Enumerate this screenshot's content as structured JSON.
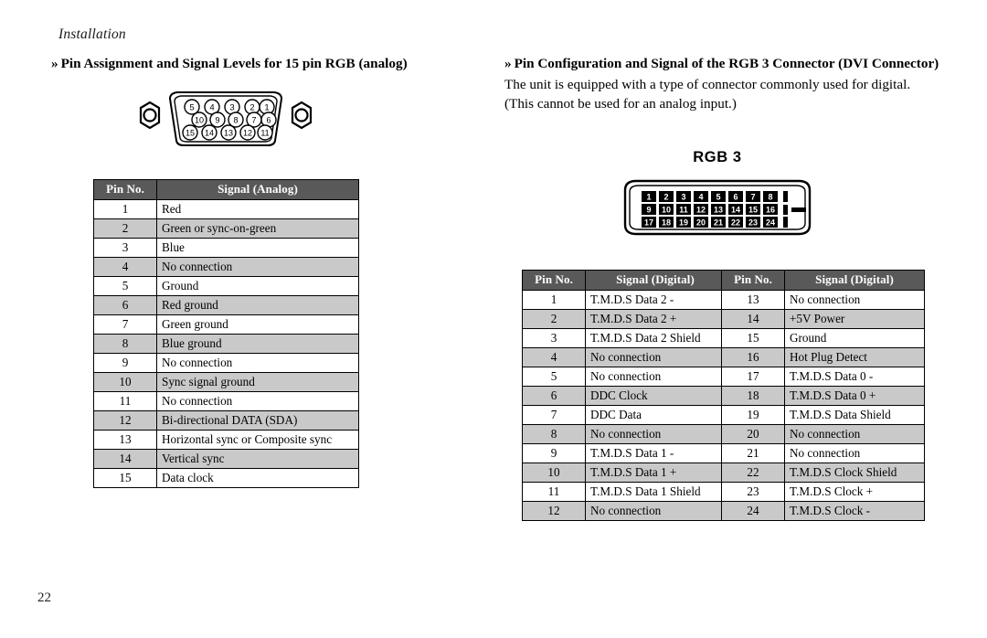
{
  "page": {
    "running_head": "Installation",
    "page_number": "22"
  },
  "left_column": {
    "heading_marker": "»",
    "heading": "Pin Assignment and Signal Levels for 15 pin RGB (analog)",
    "connector_diagram": {
      "name": "vga-d-sub-15-connector",
      "rows": [
        [
          "5",
          "4",
          "3",
          "2",
          "1"
        ],
        [
          "10",
          "9",
          "8",
          "7",
          "6"
        ],
        [
          "15",
          "14",
          "13",
          "12",
          "11"
        ]
      ]
    },
    "table": {
      "headers": [
        "Pin No.",
        "Signal (Analog)"
      ],
      "rows": [
        [
          "1",
          "Red"
        ],
        [
          "2",
          "Green or sync-on-green"
        ],
        [
          "3",
          "Blue"
        ],
        [
          "4",
          "No connection"
        ],
        [
          "5",
          "Ground"
        ],
        [
          "6",
          "Red ground"
        ],
        [
          "7",
          "Green ground"
        ],
        [
          "8",
          "Blue ground"
        ],
        [
          "9",
          "No connection"
        ],
        [
          "10",
          "Sync signal ground"
        ],
        [
          "11",
          "No connection"
        ],
        [
          "12",
          "Bi-directional DATA (SDA)"
        ],
        [
          "13",
          "Horizontal sync or Composite sync"
        ],
        [
          "14",
          "Vertical sync"
        ],
        [
          "15",
          "Data clock"
        ]
      ]
    }
  },
  "right_column": {
    "heading_marker": "»",
    "heading": "Pin Configuration and Signal of the RGB 3 Connector (DVI Connector)",
    "body": "The unit is equipped with a type of connector commonly used for digital. (This cannot be used for an analog input.)",
    "connector_label": "RGB 3",
    "connector_diagram": {
      "name": "dvi-connector",
      "rows": [
        [
          "1",
          "2",
          "3",
          "4",
          "5",
          "6",
          "7",
          "8"
        ],
        [
          "9",
          "10",
          "11",
          "12",
          "13",
          "14",
          "15",
          "16"
        ],
        [
          "17",
          "18",
          "19",
          "20",
          "21",
          "22",
          "23",
          "24"
        ]
      ]
    },
    "table_left": {
      "headers": [
        "Pin No.",
        "Signal (Digital)"
      ],
      "rows": [
        [
          "1",
          "T.M.D.S Data 2 -"
        ],
        [
          "2",
          "T.M.D.S Data 2 +"
        ],
        [
          "3",
          "T.M.D.S Data 2 Shield"
        ],
        [
          "4",
          "No connection"
        ],
        [
          "5",
          "No connection"
        ],
        [
          "6",
          "DDC Clock"
        ],
        [
          "7",
          "DDC Data"
        ],
        [
          "8",
          "No connection"
        ],
        [
          "9",
          "T.M.D.S Data 1 -"
        ],
        [
          "10",
          "T.M.D.S Data 1 +"
        ],
        [
          "11",
          "T.M.D.S Data 1 Shield"
        ],
        [
          "12",
          "No connection"
        ]
      ]
    },
    "table_right": {
      "headers": [
        "Pin No.",
        "Signal (Digital)"
      ],
      "rows": [
        [
          "13",
          "No connection"
        ],
        [
          "14",
          "+5V Power"
        ],
        [
          "15",
          "Ground"
        ],
        [
          "16",
          "Hot Plug Detect"
        ],
        [
          "17",
          "T.M.D.S Data 0 -"
        ],
        [
          "18",
          "T.M.D.S Data 0 +"
        ],
        [
          "19",
          "T.M.D.S Data Shield"
        ],
        [
          "20",
          "No connection"
        ],
        [
          "21",
          "No connection"
        ],
        [
          "22",
          "T.M.D.S Clock Shield"
        ],
        [
          "23",
          "T.M.D.S Clock +"
        ],
        [
          "24",
          "T.M.D.S Clock -"
        ]
      ]
    }
  },
  "colors": {
    "header_fill": "#595959",
    "row_shade": "#c9c9c9",
    "row_plain": "#ffffff",
    "text": "#000000"
  }
}
